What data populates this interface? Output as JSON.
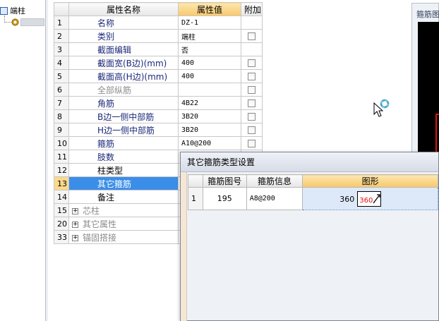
{
  "tree": {
    "root_label": "端柱"
  },
  "grid": {
    "headers": {
      "name": "属性名称",
      "value": "属性值",
      "extra": "附加"
    },
    "rows": [
      {
        "num": "1",
        "name": "名称",
        "value": "DZ-1",
        "style": "blue",
        "checkbox": false
      },
      {
        "num": "2",
        "name": "类别",
        "value": "端柱",
        "style": "blue",
        "checkbox": true
      },
      {
        "num": "3",
        "name": "截面编辑",
        "value": "否",
        "style": "blue",
        "checkbox": false
      },
      {
        "num": "4",
        "name": "截面宽(B边)(mm)",
        "value": "400",
        "style": "blue",
        "checkbox": true
      },
      {
        "num": "5",
        "name": "截面高(H边)(mm)",
        "value": "400",
        "style": "blue",
        "checkbox": true
      },
      {
        "num": "6",
        "name": "全部纵筋",
        "value": "",
        "style": "grey",
        "checkbox": true
      },
      {
        "num": "7",
        "name": "角筋",
        "value": "4B22",
        "style": "blue",
        "checkbox": true
      },
      {
        "num": "8",
        "name": "B边一侧中部筋",
        "value": "3B20",
        "style": "blue",
        "checkbox": true
      },
      {
        "num": "9",
        "name": "H边一侧中部筋",
        "value": "3B20",
        "style": "blue",
        "checkbox": true
      },
      {
        "num": "10",
        "name": "箍筋",
        "value": "A10@200",
        "style": "blue",
        "checkbox": true
      },
      {
        "num": "11",
        "name": "肢数",
        "value": "",
        "style": "blue",
        "checkbox": false
      },
      {
        "num": "12",
        "name": "柱类型",
        "value": "",
        "style": "black",
        "checkbox": false
      },
      {
        "num": "13",
        "name": "其它箍筋",
        "value": "",
        "style": "selected",
        "checkbox": false
      },
      {
        "num": "14",
        "name": "备注",
        "value": "",
        "style": "black",
        "checkbox": false
      },
      {
        "num": "15",
        "name": "芯柱",
        "value": "",
        "style": "group",
        "checkbox": false
      },
      {
        "num": "20",
        "name": "其它属性",
        "value": "",
        "style": "group",
        "checkbox": false
      },
      {
        "num": "33",
        "name": "锚固搭接",
        "value": "",
        "style": "group",
        "checkbox": false
      }
    ]
  },
  "preview": {
    "title": "箍筋图"
  },
  "dialog": {
    "title": "其它箍筋类型设置",
    "headers": {
      "code": "箍筋图号",
      "info": "箍筋信息",
      "shape": "图形"
    },
    "rows": [
      {
        "num": "1",
        "code": "195",
        "info": "A8@200",
        "length": "360",
        "shape_label": "360"
      }
    ]
  },
  "colors": {
    "selection": "#3b8ee8",
    "header_highlight": "#f7c86a",
    "name_text": "#1c2a7a",
    "shape_red": "#e01010"
  }
}
